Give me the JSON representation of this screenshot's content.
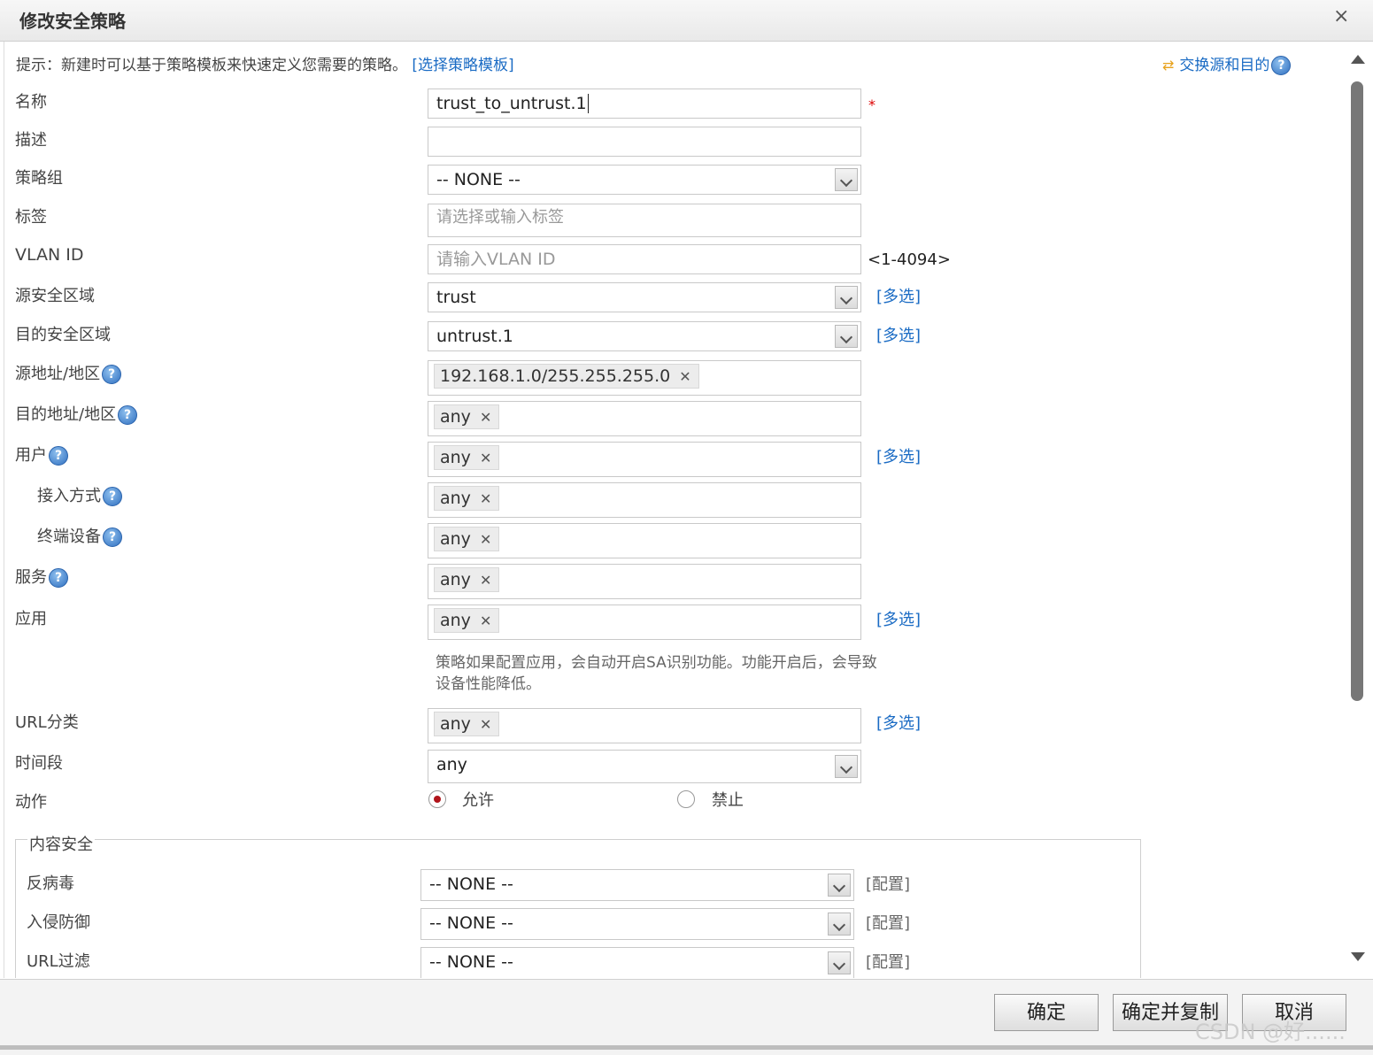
{
  "dialog": {
    "title": "修改安全策略",
    "close_icon": "×"
  },
  "hint": {
    "prefix": "提示：新建时可以基于策略模板来快速定义您需要的策略。",
    "template_link": "[选择策略模板]"
  },
  "swap": {
    "label": "交换源和目的"
  },
  "help_glyph": "?",
  "form": {
    "name": {
      "label": "名称",
      "value": "trust_to_untrust.1",
      "required_mark": "*"
    },
    "description": {
      "label": "描述",
      "value": ""
    },
    "policy_group": {
      "label": "策略组",
      "value": "-- NONE --"
    },
    "tag": {
      "label": "标签",
      "placeholder": "请选择或输入标签"
    },
    "vlan": {
      "label": "VLAN ID",
      "placeholder": "请输入VLAN ID",
      "range": "<1-4094>"
    },
    "src_zone": {
      "label": "源安全区域",
      "value": "trust",
      "multi": "[多选]"
    },
    "dst_zone": {
      "label": "目的安全区域",
      "value": "untrust.1",
      "multi": "[多选]"
    },
    "src_addr": {
      "label": "源地址/地区",
      "tag": "192.168.1.0/255.255.255.0"
    },
    "dst_addr": {
      "label": "目的地址/地区",
      "tag": "any"
    },
    "user": {
      "label": "用户",
      "tag": "any",
      "multi": "[多选]"
    },
    "access": {
      "label": "接入方式",
      "tag": "any"
    },
    "terminal": {
      "label": "终端设备",
      "tag": "any"
    },
    "service": {
      "label": "服务",
      "tag": "any"
    },
    "application": {
      "label": "应用",
      "tag": "any",
      "multi": "[多选]",
      "note": "策略如果配置应用，会自动开启SA识别功能。功能开启后，会导致设备性能降低。"
    },
    "url_category": {
      "label": "URL分类",
      "tag": "any",
      "multi": "[多选]"
    },
    "time_range": {
      "label": "时间段",
      "value": "any"
    },
    "action": {
      "label": "动作",
      "allow": "允许",
      "deny": "禁止",
      "selected": "allow"
    }
  },
  "content_security": {
    "legend": "内容安全",
    "antivirus": {
      "label": "反病毒",
      "value": "-- NONE --",
      "config": "[配置]"
    },
    "ips": {
      "label": "入侵防御",
      "value": "-- NONE --",
      "config": "[配置]"
    },
    "url_filter": {
      "label": "URL过滤",
      "value": "-- NONE --",
      "config": "[配置]"
    }
  },
  "buttons": {
    "ok": "确定",
    "ok_copy": "确定并复制",
    "cancel": "取消"
  },
  "watermark": "CSDN @好......"
}
